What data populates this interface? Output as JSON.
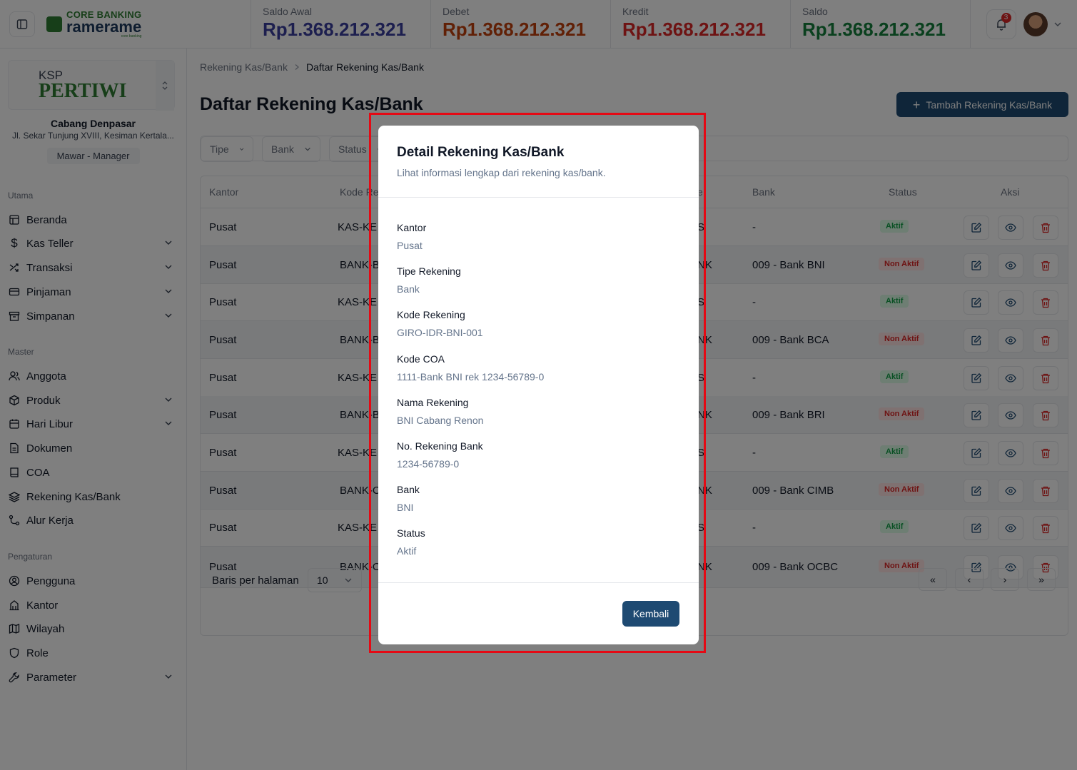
{
  "header": {
    "logo_top": "CORE BANKING",
    "logo_main": "ramerame",
    "logo_small": "core banking",
    "stats": [
      {
        "label": "Saldo Awal",
        "value": "Rp1.368.212.321",
        "color": "#3b3f9e"
      },
      {
        "label": "Debet",
        "value": "Rp1.368.212.321",
        "color": "#c2410c"
      },
      {
        "label": "Kredit",
        "value": "Rp1.368.212.321",
        "color": "#dc2626"
      },
      {
        "label": "Saldo",
        "value": "Rp1.368.212.321",
        "color": "#15803d"
      }
    ],
    "notification_count": "3"
  },
  "sidebar": {
    "org_logo_top": "KSP",
    "org_logo_main": "PERTIWI",
    "branch_name": "Cabang Denpasar",
    "branch_address": "Jl. Sekar Tunjung XVIII, Kesiman Kertala...",
    "user_role": "Mawar - Manager",
    "sections": [
      {
        "title": "Utama",
        "items": [
          {
            "label": "Beranda",
            "icon": "home-icon"
          },
          {
            "label": "Kas Teller",
            "icon": "dollar-icon"
          },
          {
            "label": "Transaksi",
            "icon": "shuffle-icon"
          },
          {
            "label": "Pinjaman",
            "icon": "card-icon"
          },
          {
            "label": "Simpanan",
            "icon": "archive-icon"
          }
        ]
      },
      {
        "title": "Master",
        "items": [
          {
            "label": "Anggota",
            "icon": "users-icon"
          },
          {
            "label": "Produk",
            "icon": "package-icon"
          },
          {
            "label": "Hari Libur",
            "icon": "calendar-icon"
          },
          {
            "label": "Dokumen",
            "icon": "file-icon"
          },
          {
            "label": "COA",
            "icon": "book-icon"
          },
          {
            "label": "Rekening Kas/Bank",
            "icon": "layers-icon"
          },
          {
            "label": "Alur Kerja",
            "icon": "workflow-icon"
          }
        ]
      },
      {
        "title": "Pengaturan",
        "items": [
          {
            "label": "Pengguna",
            "icon": "user-circle-icon"
          },
          {
            "label": "Kantor",
            "icon": "building-icon"
          },
          {
            "label": "Wilayah",
            "icon": "map-icon"
          },
          {
            "label": "Role",
            "icon": "shield-icon"
          },
          {
            "label": "Parameter",
            "icon": "wrench-icon"
          }
        ]
      }
    ]
  },
  "main": {
    "breadcrumb": [
      "Rekening Kas/Bank",
      "Daftar Rekening Kas/Bank"
    ],
    "title": "Daftar Rekening Kas/Bank",
    "add_button": "Tambah Rekening Kas/Bank",
    "filters": [
      "Tipe",
      "Bank",
      "Status"
    ],
    "columns": [
      "Kantor",
      "Kode Re",
      "e",
      "Bank",
      "Status",
      "Aksi"
    ],
    "rows": [
      {
        "kantor": "Pusat",
        "kode": "KAS-KE",
        "tipe": "S",
        "bank": "-",
        "status": "Aktif"
      },
      {
        "kantor": "Pusat",
        "kode": "BANK-B",
        "tipe": "NK",
        "bank": "009 - Bank BNI",
        "status": "Non Aktif"
      },
      {
        "kantor": "Pusat",
        "kode": "KAS-KE",
        "tipe": "S",
        "bank": "-",
        "status": "Aktif"
      },
      {
        "kantor": "Pusat",
        "kode": "BANK-B",
        "tipe": "NK",
        "bank": "009 - Bank BCA",
        "status": "Non Aktif"
      },
      {
        "kantor": "Pusat",
        "kode": "KAS-KE",
        "tipe": "S",
        "bank": "-",
        "status": "Aktif"
      },
      {
        "kantor": "Pusat",
        "kode": "BANK-B",
        "tipe": "NK",
        "bank": "009 - Bank BRI",
        "status": "Non Aktif"
      },
      {
        "kantor": "Pusat",
        "kode": "KAS-KE",
        "tipe": "S",
        "bank": "-",
        "status": "Aktif"
      },
      {
        "kantor": "Pusat",
        "kode": "BANK-C",
        "tipe": "NK",
        "bank": "009 - Bank CIMB",
        "status": "Non Aktif"
      },
      {
        "kantor": "Pusat",
        "kode": "KAS-KE",
        "tipe": "S",
        "bank": "-",
        "status": "Aktif"
      },
      {
        "kantor": "Pusat",
        "kode": "BANK-O",
        "tipe": "NK",
        "bank": "009 - Bank OCBC",
        "status": "Non Aktif"
      }
    ],
    "pagination": {
      "label": "Baris per halaman",
      "page_size": "10"
    }
  },
  "modal": {
    "title": "Detail Rekening Kas/Bank",
    "subtitle": "Lihat informasi lengkap dari rekening kas/bank.",
    "fields": [
      {
        "label": "Kantor",
        "value": "Pusat"
      },
      {
        "label": "Tipe Rekening",
        "value": "Bank"
      },
      {
        "label": "Kode Rekening",
        "value": "GIRO-IDR-BNI-001"
      },
      {
        "label": "Kode COA",
        "value": "1111-Bank BNI rek 1234-56789-0"
      },
      {
        "label": "Nama Rekening",
        "value": "BNI Cabang Renon"
      },
      {
        "label": "No. Rekening Bank",
        "value": "1234-56789-0"
      },
      {
        "label": "Bank",
        "value": "BNI"
      },
      {
        "label": "Status",
        "value": "Aktif"
      }
    ],
    "back_button": "Kembali"
  }
}
